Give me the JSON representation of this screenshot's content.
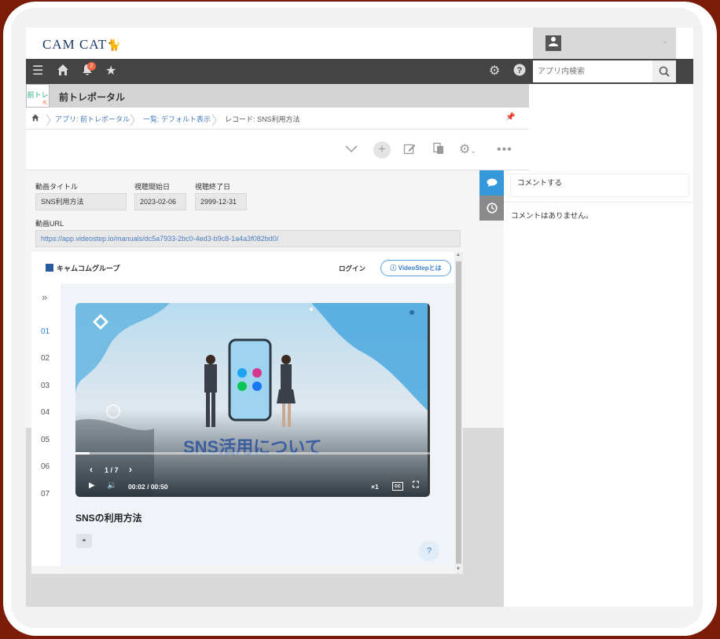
{
  "header": {
    "logo_text": "CAM CAT",
    "user_chevron": "⌄"
  },
  "navbar": {
    "notification_count": "2",
    "search_placeholder": "アプリ内検索"
  },
  "app": {
    "icon_text": "前トレ",
    "title": "前トレポータル"
  },
  "breadcrumb": {
    "items": [
      "アプリ: 前トレポータル",
      "一覧: デフォルト表示",
      "レコード: SNS利用方法"
    ]
  },
  "record": {
    "fields": {
      "title_label": "動画タイトル",
      "title_value": "SNS利用方法",
      "start_label": "視聴開始日",
      "start_value": "2023-02-06",
      "end_label": "視聴終了日",
      "end_value": "2999-12-31",
      "url_label": "動画URL",
      "url_value": "https://app.videostep.io/manuals/dc5a7933-2bc0-4ed3-b9c8-1a4a3f082bd0/"
    }
  },
  "comments": {
    "input_placeholder": "コメントする",
    "empty_text": "コメントはありません。"
  },
  "embed": {
    "brand": "キャムコムグループ",
    "login": "ログイン",
    "videostep_button": "VideoStepとは",
    "steps": [
      "01",
      "02",
      "03",
      "04",
      "05",
      "06",
      "07"
    ],
    "active_step": "01",
    "video": {
      "title_overlay": "SNS活用について",
      "step_indicator": "1 / 7",
      "time": "00:02 / 00:50",
      "speed": "×1",
      "progress": 0.04
    },
    "caption": "SNSの利用方法",
    "help": "?"
  },
  "colors": {
    "navbar": "#444444",
    "accent_blue": "#3498db",
    "link": "#4a7cc0"
  }
}
